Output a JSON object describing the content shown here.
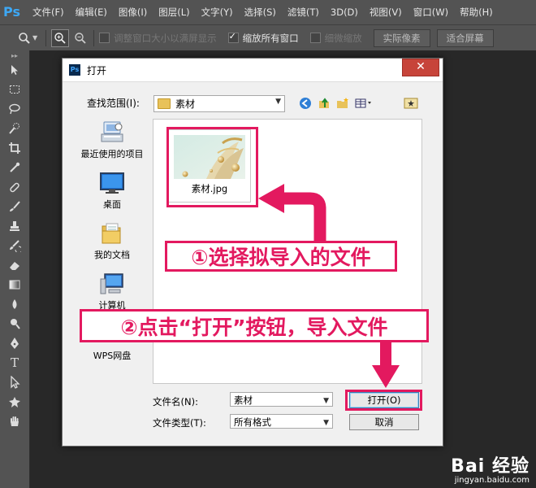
{
  "app": {
    "logo": "Ps",
    "menu": [
      "文件(F)",
      "编辑(E)",
      "图像(I)",
      "图层(L)",
      "文字(Y)",
      "选择(S)",
      "滤镜(T)",
      "3D(D)",
      "视图(V)",
      "窗口(W)",
      "帮助(H)"
    ]
  },
  "options_bar": {
    "resize_windows_label": "调整窗口大小以满屏显示",
    "zoom_all_windows_label": "缩放所有窗口",
    "scrubby_zoom_label": "细微缩放",
    "actual_pixels_label": "实际像素",
    "fit_screen_label": "适合屏幕",
    "resize_windows_checked": false,
    "zoom_all_windows_checked": true,
    "scrubby_zoom_checked": false
  },
  "dialog": {
    "title": "打开",
    "title_icon": "Ps",
    "close_glyph": "✕",
    "look_in_label": "查找范围(I):",
    "look_in_value": "素材",
    "places": [
      {
        "label": "最近使用的项目",
        "icon": "recent-places-icon"
      },
      {
        "label": "桌面",
        "icon": "desktop-icon"
      },
      {
        "label": "我的文档",
        "icon": "my-documents-icon"
      },
      {
        "label": "计算机",
        "icon": "computer-icon"
      },
      {
        "label": "WPS网盘",
        "icon": "wps-cloud-icon"
      }
    ],
    "files": [
      {
        "name": "素材.jpg"
      }
    ],
    "file_name_label": "文件名(N):",
    "file_name_value": "素材",
    "file_type_label": "文件类型(T):",
    "file_type_value": "所有格式",
    "open_button": "打开(O)",
    "cancel_button": "取消"
  },
  "annotations": {
    "step1": "①选择拟导入的文件",
    "step2": "②点击“打开”按钮，导入文件",
    "color": "#e3195f"
  },
  "watermark": {
    "brand": "Bai 经验",
    "url": "jingyan.baidu.com"
  }
}
